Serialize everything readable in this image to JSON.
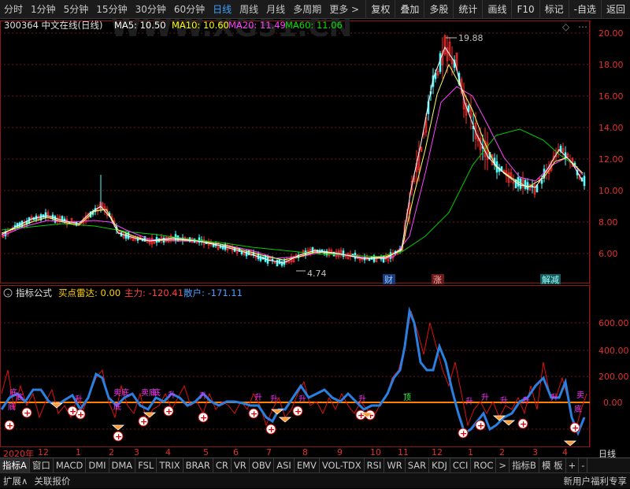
{
  "topbar": {
    "periods": [
      "分时",
      "1分钟",
      "5分钟",
      "15分钟",
      "30分钟",
      "60分钟",
      "日线",
      "周线",
      "月线",
      "多周期",
      "更多 >"
    ],
    "active_period": "日线",
    "actions": [
      "复权",
      "叠加",
      "多股",
      "统计",
      "画线",
      "F10",
      "标记",
      "-自选",
      "返回"
    ]
  },
  "price_panel": {
    "code_name": "300364 中文在线(日线)",
    "ma5": "MA5: 10.50",
    "ma10": "MA10: 10.60",
    "ma20": "MA20: 11.49",
    "ma60": "MA60: 11.06",
    "high_marker": "19.88",
    "low_marker": "4.74",
    "y_ticks": [
      "20.00",
      "18.00",
      "16.00",
      "14.00",
      "12.00",
      "10.00",
      "8.00",
      "6.00"
    ],
    "events": [
      "财",
      "涨",
      "解减"
    ],
    "watermark": "WWW.XG51.CN"
  },
  "indicator_panel": {
    "title": "指标公式",
    "buy_radar": "买点雷达: 0.00",
    "main_force": "主力: -120.41",
    "retail": "散户: -171.11",
    "y_ticks": [
      "600.00",
      "400.00",
      "200.00",
      "0.00"
    ],
    "labels": {
      "bottom": "底",
      "top": "顶",
      "rise": "升",
      "fall": "卖底"
    }
  },
  "datebar": {
    "months": [
      "2020年",
      "12",
      "1",
      "2",
      "3",
      "4",
      "5",
      "6",
      "7",
      "8",
      "9",
      "10",
      "11",
      "12",
      "1",
      "2",
      "3",
      "4"
    ],
    "period": "日线"
  },
  "tabbar": {
    "items": [
      "指标A",
      "窗口",
      "MACD",
      "DMI",
      "DMA",
      "FSL",
      "TRIX",
      "BRAR",
      "CR",
      "VR",
      "OBV",
      "ASI",
      "EMV",
      "VOL-TDX",
      "RSI",
      "WR",
      "SAR",
      "KDJ",
      "CCI",
      "ROC",
      ">",
      "指标B",
      "模 板",
      "+",
      "-"
    ]
  },
  "statusbar": {
    "left1": "扩展∧",
    "left2": "关联报价",
    "right": "新用户福利专享"
  },
  "colors": {
    "bg": "#000000",
    "grid": "#7a1a1a",
    "red": "#ff3030",
    "cyan": "#54fcfc",
    "yellow": "#ffff00",
    "magenta": "#ff44ff",
    "green": "#00e000",
    "blue": "#2a7fd8",
    "orange": "#ff8000"
  },
  "chart_data": {
    "type": "line",
    "title": "300364 中文在线(日线)",
    "ylim": [
      4,
      21
    ],
    "series": [
      {
        "name": "MA60",
        "values": [
          7.6,
          7.7,
          7.8,
          7.7,
          7.6,
          7.5,
          7.3,
          7.2,
          7.0,
          6.8,
          6.5,
          6.2,
          5.9,
          5.8,
          6.0,
          7.0,
          9.5,
          11.5,
          13.3,
          13.9,
          13.6,
          12.5,
          11.8,
          11.1
        ]
      },
      {
        "name": "MA20",
        "values": [
          7.6,
          7.9,
          7.6,
          7.3,
          7.0,
          6.8,
          6.6,
          6.3,
          6.0,
          5.8,
          5.8,
          5.8,
          5.6,
          5.6,
          6.5,
          11.0,
          16.0,
          16.5,
          14.5,
          12.0,
          10.5,
          10.5,
          11.5,
          11.5
        ]
      }
    ],
    "low": 4.74,
    "high": 19.88
  }
}
